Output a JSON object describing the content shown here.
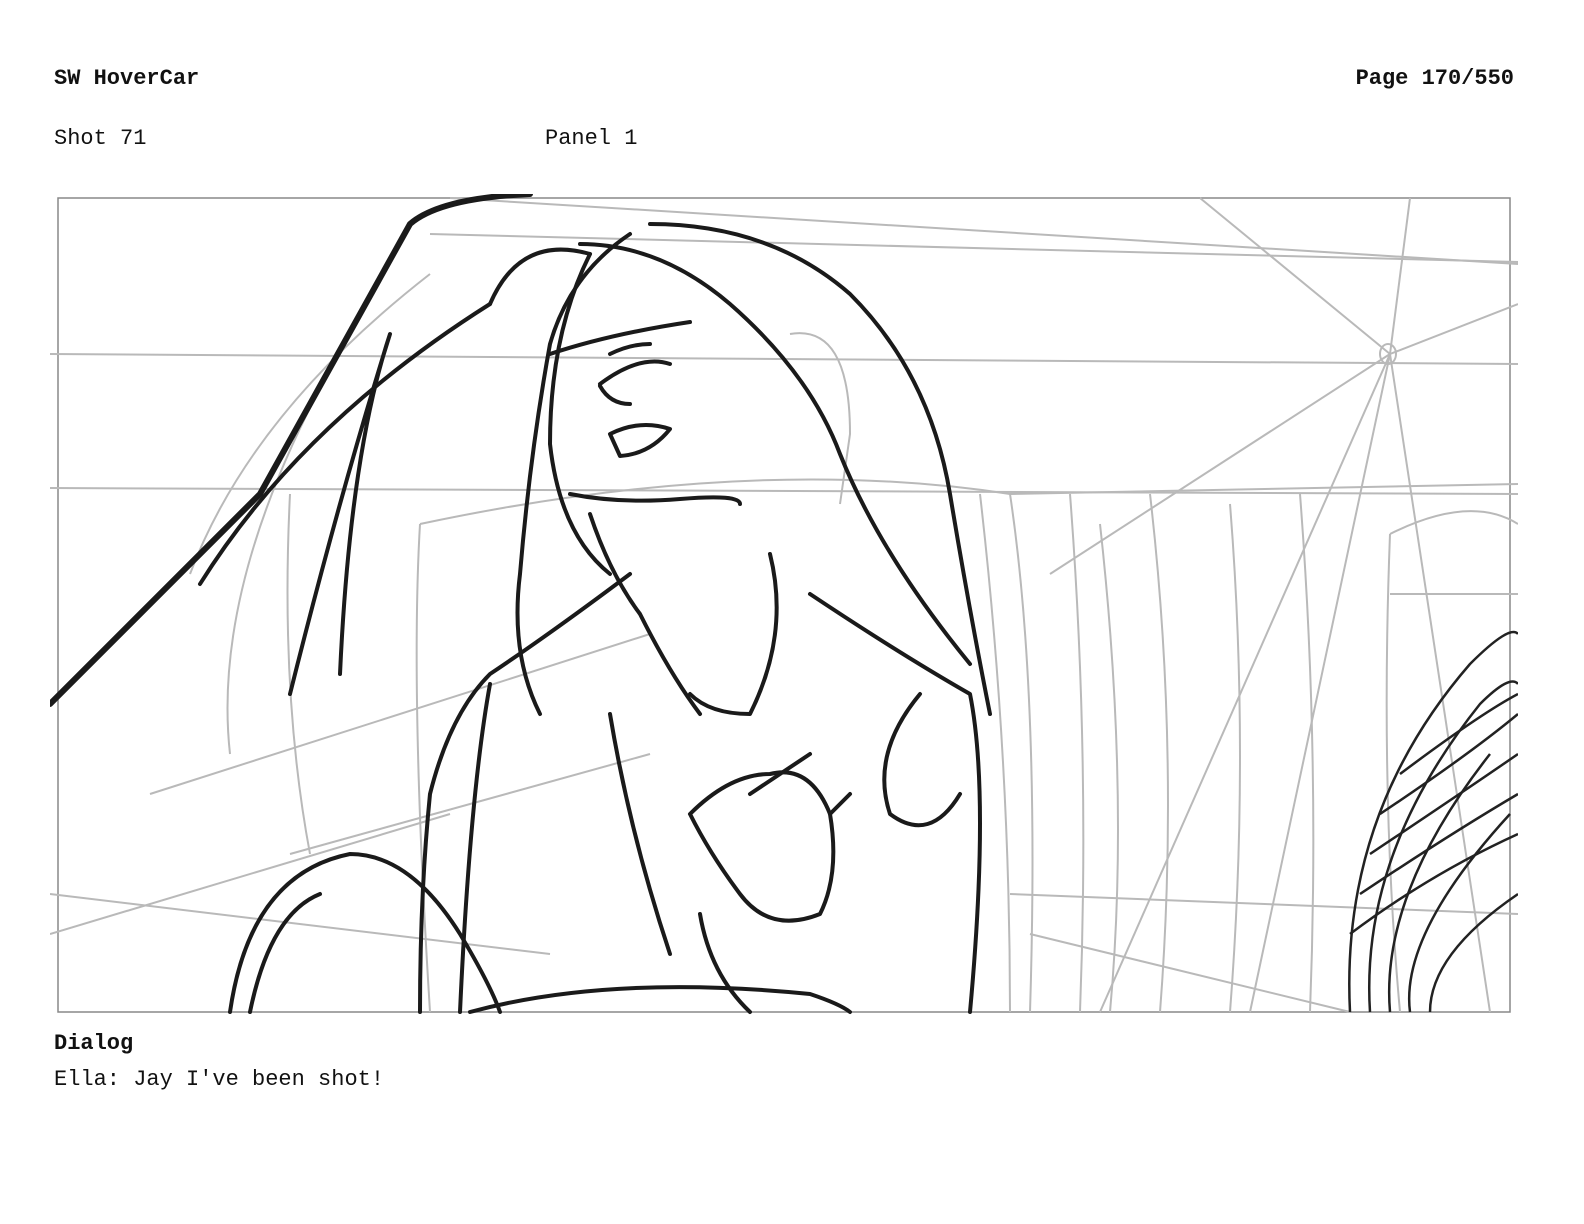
{
  "header": {
    "project_title": "SW HoverCar",
    "page_label": "Page 170/550"
  },
  "shot": {
    "shot_label": "Shot 71",
    "panel_label": "Panel 1"
  },
  "panel_image": {
    "description_icon": "storyboard-sketch-icon"
  },
  "dialog": {
    "label": "Dialog",
    "text": "Ella: Jay I've been shot!"
  }
}
